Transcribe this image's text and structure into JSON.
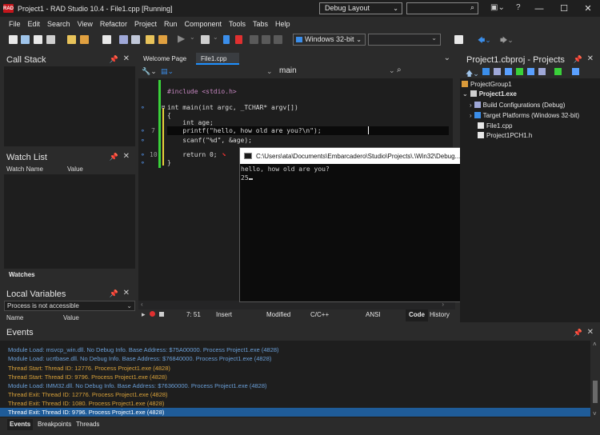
{
  "window": {
    "icon_text": "RAD",
    "title": "Project1 - RAD Studio 10.4 - File1.cpp [Running]",
    "layout": "Debug Layout",
    "help_icon": "?",
    "min_icon": "—",
    "max_icon": "☐",
    "close_icon": "✕"
  },
  "menu": [
    "File",
    "Edit",
    "Search",
    "View",
    "Refactor",
    "Project",
    "Run",
    "Component",
    "Tools",
    "Tabs",
    "Help"
  ],
  "toolbar": {
    "platform": "Windows 32-bit",
    "config": ""
  },
  "call_stack": {
    "title": "Call Stack"
  },
  "watch_list": {
    "title": "Watch List",
    "col_name": "Watch Name",
    "col_value": "Value",
    "tab": "Watches"
  },
  "local_vars": {
    "title": "Local Variables",
    "dropdown": "Process is not accessible",
    "col_name": "Name",
    "col_value": "Value"
  },
  "editor": {
    "tabs": [
      "Welcome Page",
      "File1.cpp"
    ],
    "function_nav": "main",
    "lines": [
      {
        "num": "",
        "text": "#include <stdio.h>",
        "color": "#c586c0"
      },
      {
        "num": "",
        "text": "int main(int argc, _TCHAR* argv[])",
        "color": "#dcdcdc"
      },
      {
        "num": "",
        "text": "{",
        "color": "#dcdcdc"
      },
      {
        "num": "",
        "text": "    int age;",
        "color": "#dcdcdc"
      },
      {
        "num": "7",
        "text": "    printf(\"hello, how old are you?\\n\");",
        "color": "#dcdcdc"
      },
      {
        "num": "",
        "text": "    scanf(\"%d\", &age);",
        "color": "#dcdcdc"
      },
      {
        "num": "",
        "text": "",
        "color": "#dcdcdc"
      },
      {
        "num": "10",
        "text": "    return 0;",
        "color": "#dcdcdc"
      },
      {
        "num": "",
        "text": "}",
        "color": "#dcdcdc"
      }
    ],
    "status": {
      "position": "7: 51",
      "mode": "Insert",
      "modified": "Modified",
      "language": "C/C++",
      "encoding": "ANSI",
      "tab_code": "Code",
      "tab_history": "History"
    }
  },
  "console": {
    "title": "C:\\Users\\ata\\Documents\\Embarcadero\\Studio\\Projects\\.\\Win32\\Debug...",
    "lines": [
      "hello, how old are you?",
      "25"
    ]
  },
  "project": {
    "title": "Project1.cbproj - Projects",
    "items": [
      {
        "label": "ProjectGroup1",
        "indent": 0,
        "bold": false
      },
      {
        "label": "Project1.exe",
        "indent": 1,
        "bold": true
      },
      {
        "label": "Build Configurations (Debug)",
        "indent": 2,
        "bold": false
      },
      {
        "label": "Target Platforms (Windows 32-bit)",
        "indent": 2,
        "bold": false
      },
      {
        "label": "File1.cpp",
        "indent": 2,
        "bold": false
      },
      {
        "label": "Project1PCH1.h",
        "indent": 2,
        "bold": false
      }
    ]
  },
  "events": {
    "title": "Events",
    "lines": [
      {
        "text": "Module Load: msvcp_win.dll. No Debug Info. Base Address: $75A00000. Process Project1.exe (4828)",
        "color": "#6a9fd8"
      },
      {
        "text": "Module Load: ucrtbase.dll. No Debug Info. Base Address: $76840000. Process Project1.exe (4828)",
        "color": "#6a9fd8"
      },
      {
        "text": "Thread Start: Thread ID: 12776. Process Project1.exe (4828)",
        "color": "#d9a23a"
      },
      {
        "text": "Thread Start: Thread ID: 9796. Process Project1.exe (4828)",
        "color": "#d9a23a"
      },
      {
        "text": "Module Load: IMM32.dll. No Debug Info. Base Address: $76360000. Process Project1.exe (4828)",
        "color": "#6a9fd8"
      },
      {
        "text": "Thread Exit: Thread ID: 12776. Process Project1.exe (4828)",
        "color": "#d9a23a"
      },
      {
        "text": "Thread Exit: Thread ID: 1080. Process Project1.exe (4828)",
        "color": "#d9a23a"
      },
      {
        "text": "Thread Exit: Thread ID: 9796. Process Project1.exe (4828)",
        "color": "#ffffff"
      }
    ],
    "tabs": [
      "Events",
      "Breakpoints",
      "Threads"
    ]
  }
}
